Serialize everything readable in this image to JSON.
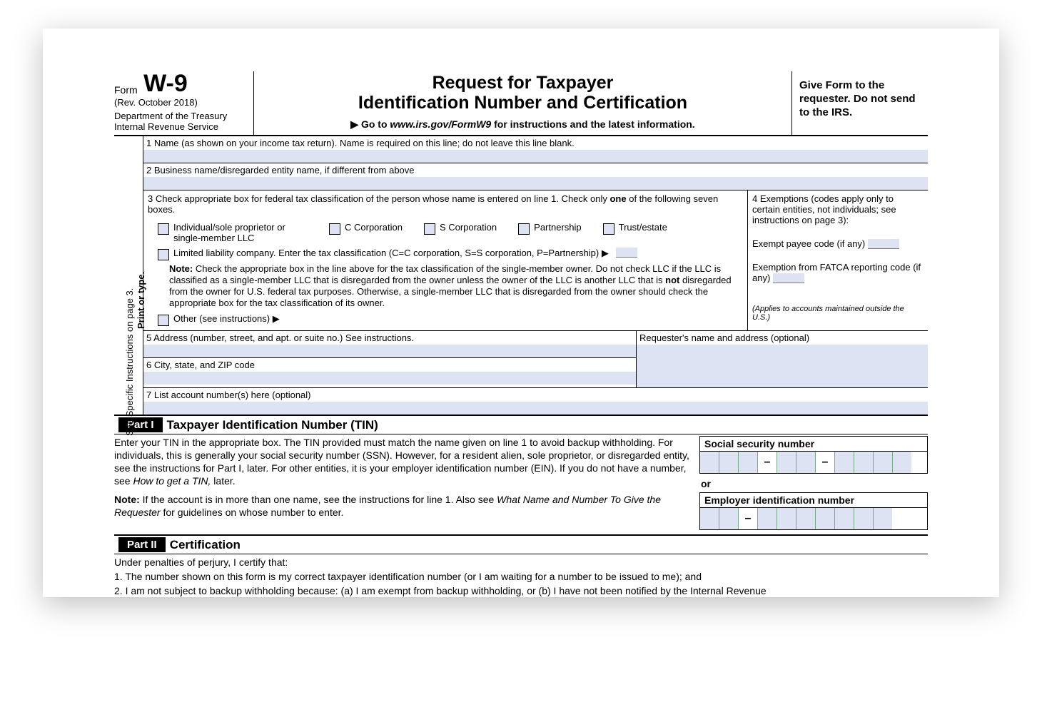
{
  "header": {
    "form_word": "Form",
    "form_number": "W-9",
    "revision": "(Rev. October 2018)",
    "department": "Department of the Treasury\nInternal Revenue Service",
    "title_line1": "Request for Taxpayer",
    "title_line2": "Identification Number and Certification",
    "goto_prefix": "▶ Go to ",
    "goto_url": "www.irs.gov/FormW9",
    "goto_suffix": " for instructions and the latest information.",
    "right_note": "Give Form to the requester. Do not send to the IRS."
  },
  "side": {
    "specific": "See Specific Instructions on page 3.",
    "print": "Print or type."
  },
  "lines": {
    "l1": "1  Name (as shown on your income tax return). Name is required on this line; do not leave this line blank.",
    "l2": "2  Business name/disregarded entity name, if different from above",
    "l3_intro_a": "3  Check appropriate box for federal tax classification of the person whose name is entered on line 1. Check only ",
    "l3_intro_b": "one",
    "l3_intro_c": " of the following seven boxes.",
    "l4_intro": "4  Exemptions (codes apply only to certain entities, not individuals; see instructions on page 3):",
    "chk_individual": "Individual/sole proprietor or single-member LLC",
    "chk_ccorp": "C Corporation",
    "chk_scorp": "S Corporation",
    "chk_partnership": "Partnership",
    "chk_trust": "Trust/estate",
    "llc_text": "Limited liability company. Enter the tax classification (C=C corporation, S=S corporation, P=Partnership) ▶",
    "note3_bold": "Note:",
    "note3_a": " Check the appropriate box in the line above for the tax classification of the single-member owner. Do not check LLC if the LLC is classified as a single-member LLC that is disregarded from the owner unless the owner of the LLC is another LLC that is ",
    "note3_not": "not",
    "note3_b": " disregarded from the owner for U.S. federal tax purposes. Otherwise, a single-member LLC that is disregarded from the owner should check the appropriate box for the tax classification of its owner.",
    "other": "Other (see instructions) ▶",
    "exempt_payee": "Exempt payee code (if any)",
    "fatca": "Exemption from FATCA reporting code (if any)",
    "fatca_note": "(Applies to accounts maintained outside the U.S.)",
    "l5": "5  Address (number, street, and apt. or suite no.) See instructions.",
    "requester": "Requester's name and address (optional)",
    "l6": "6  City, state, and ZIP code",
    "l7": "7  List account number(s) here (optional)"
  },
  "part1": {
    "tag": "Part I",
    "title": "Taxpayer Identification Number (TIN)",
    "text_a": "Enter your TIN in the appropriate box. The TIN provided must match the name given on line 1 to avoid backup withholding. For individuals, this is generally your social security number (SSN). However, for a resident alien, sole proprietor, or disregarded entity, see the instructions for Part I, later. For other entities, it is your employer identification number (EIN). If you do not have a number, see ",
    "text_em1": "How to get a TIN,",
    "text_b": " later.",
    "note_bold": "Note:",
    "note_a": " If the account is in more than one name, see the instructions for line 1. Also see ",
    "note_em": "What Name and Number To Give the Requester",
    "note_b": " for guidelines on whose number to enter.",
    "ssn_label": "Social security number",
    "or": "or",
    "ein_label": "Employer identification number"
  },
  "part2": {
    "tag": "Part II",
    "title": "Certification",
    "intro": "Under penalties of perjury, I certify that:",
    "item1": "1. The number shown on this form is my correct taxpayer identification number (or I am waiting for a number to be issued to me); and",
    "item2": "2. I am not subject to backup withholding because: (a) I am exempt from backup withholding, or (b) I have not been notified by the Internal Revenue"
  }
}
